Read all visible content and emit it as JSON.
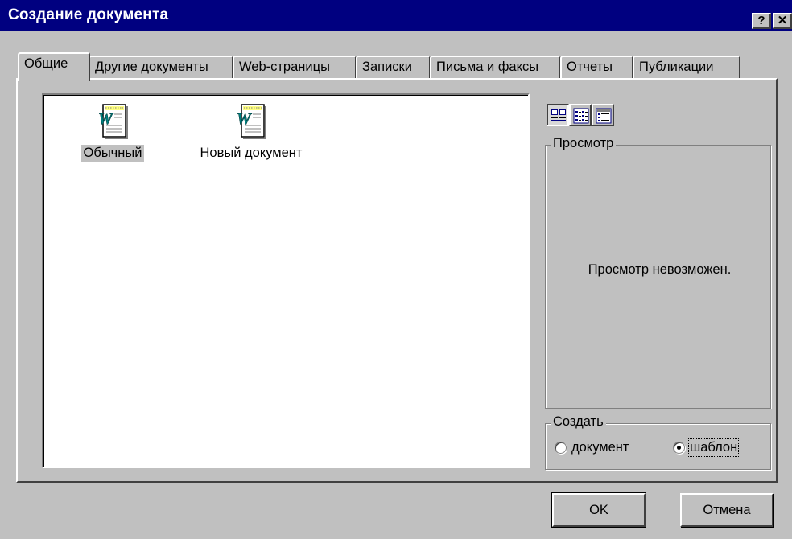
{
  "window": {
    "title": "Создание документа",
    "help_label": "?",
    "close_label": "✕"
  },
  "tabs": [
    {
      "label": "Общие",
      "active": true
    },
    {
      "label": "Другие документы"
    },
    {
      "label": "Web-страницы"
    },
    {
      "label": "Записки"
    },
    {
      "label": "Письма и факсы"
    },
    {
      "label": "Отчеты"
    },
    {
      "label": "Публикации"
    }
  ],
  "files": [
    {
      "label": "Обычный",
      "icon": "word-template-icon",
      "selected": true
    },
    {
      "label": "Новый документ",
      "icon": "word-template-icon"
    }
  ],
  "view_buttons": [
    {
      "icon": "large-icons-view-icon",
      "pressed": true
    },
    {
      "icon": "list-view-icon"
    },
    {
      "icon": "details-view-icon"
    }
  ],
  "preview": {
    "legend": "Просмотр",
    "message": "Просмотр невозможен."
  },
  "create": {
    "legend": "Создать",
    "option_document": "документ",
    "option_template": "шаблон",
    "selected": "шаблон"
  },
  "buttons": {
    "ok": "OK",
    "cancel": "Отмена"
  },
  "colors": {
    "titlebar": "#000080",
    "face": "#c0c0c0",
    "list_bg": "#ffffff"
  }
}
